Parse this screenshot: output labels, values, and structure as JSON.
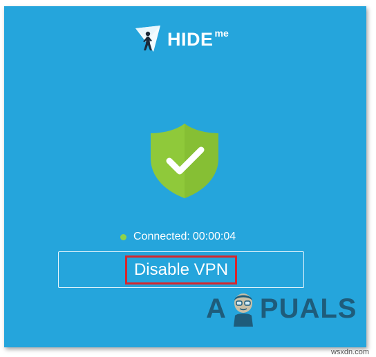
{
  "app": {
    "brand_name": "HIDE",
    "brand_suffix": "me"
  },
  "status": {
    "label": "Connected:",
    "timer": "00:00:04",
    "indicator_color": "#8fd34a"
  },
  "actions": {
    "disable_label": "Disable VPN"
  },
  "colors": {
    "background": "#25a5dc",
    "shield": "#8fc93a",
    "highlight_box": "#d7262c"
  },
  "watermark": {
    "left_text": "A",
    "right_text": "PUALS"
  },
  "site_credit": "wsxdn.com"
}
